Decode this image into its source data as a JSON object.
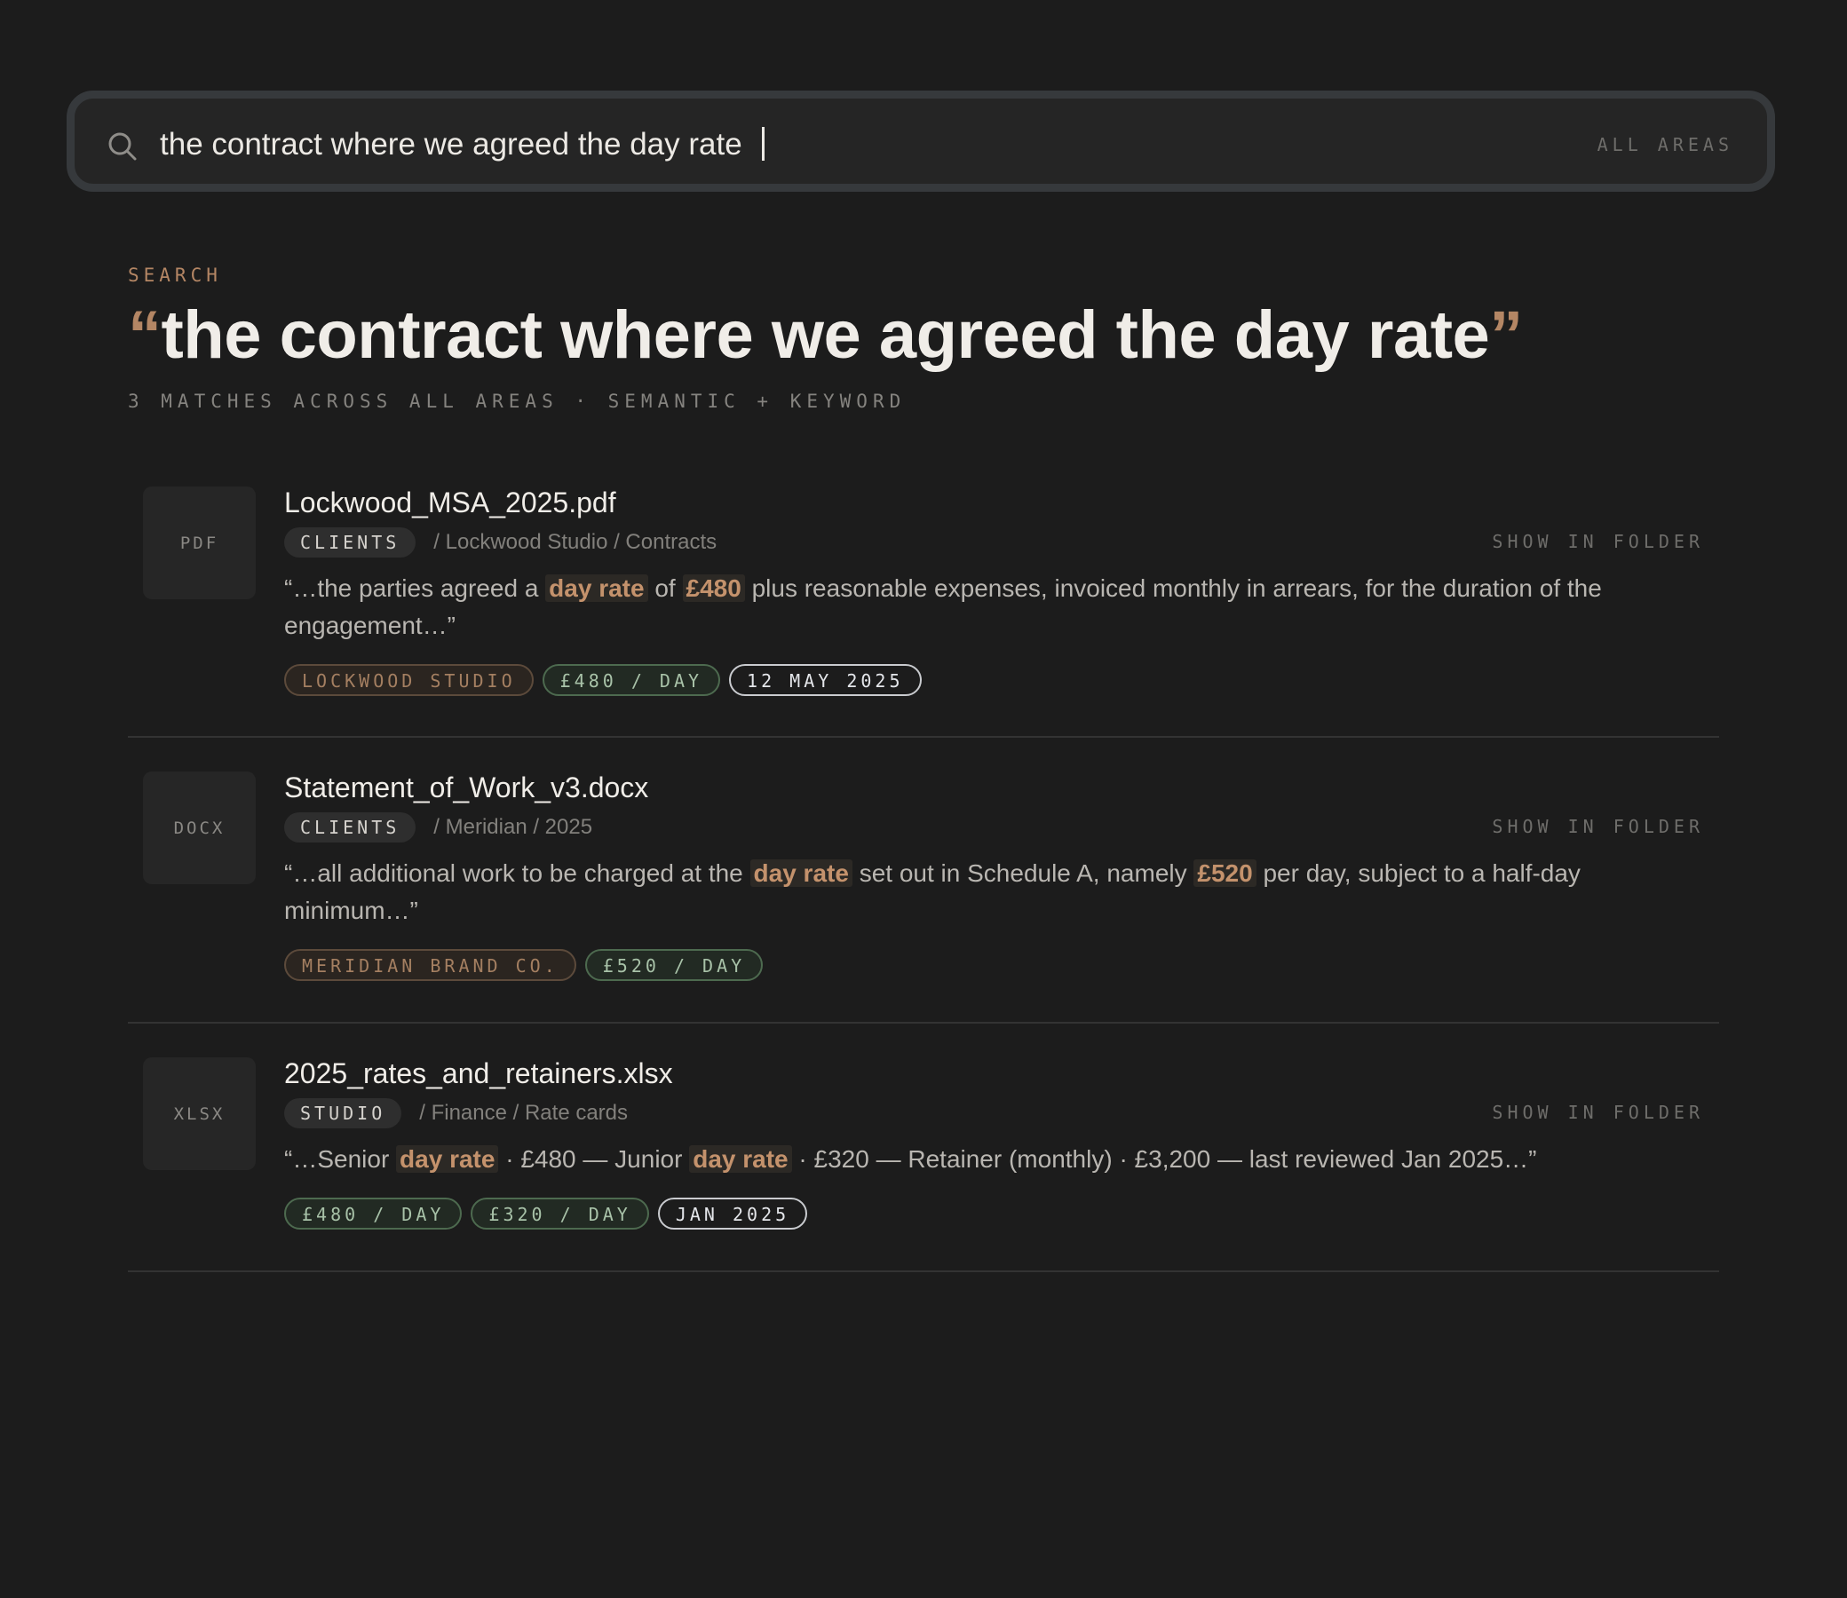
{
  "search": {
    "query": "the contract where we agreed the day rate",
    "scope": "ALL AREAS"
  },
  "header": {
    "eyebrow": "SEARCH",
    "open_quote": "“",
    "title": "the contract where we agreed the day rate",
    "close_quote": "”",
    "summary": "3 MATCHES ACROSS ALL AREAS · SEMANTIC + KEYWORD"
  },
  "results": [
    {
      "type": "PDF",
      "filename": "Lockwood_MSA_2025.pdf",
      "area": "CLIENTS",
      "path": "/ Lockwood Studio / Contracts",
      "action": "SHOW IN FOLDER",
      "snippet": [
        {
          "t": "“…the parties agreed a "
        },
        {
          "t": "day rate",
          "hl": true
        },
        {
          "t": " of "
        },
        {
          "t": "£480",
          "hl": true
        },
        {
          "t": " plus reasonable expenses, invoiced monthly in arrears, for the duration of the engagement…”"
        }
      ],
      "tags": [
        {
          "label": "LOCKWOOD STUDIO",
          "kind": "org"
        },
        {
          "label": "£480 / DAY",
          "kind": "rate"
        },
        {
          "label": "12 MAY 2025",
          "kind": "date"
        }
      ]
    },
    {
      "type": "DOCX",
      "filename": "Statement_of_Work_v3.docx",
      "area": "CLIENTS",
      "path": "/ Meridian / 2025",
      "action": "SHOW IN FOLDER",
      "snippet": [
        {
          "t": "“…all additional work to be charged at the "
        },
        {
          "t": "day rate",
          "hl": true
        },
        {
          "t": " set out in Schedule A, namely "
        },
        {
          "t": "£520",
          "hl": true
        },
        {
          "t": " per day, subject to a half-day minimum…”"
        }
      ],
      "tags": [
        {
          "label": "MERIDIAN BRAND CO.",
          "kind": "org"
        },
        {
          "label": "£520 / DAY",
          "kind": "rate"
        }
      ]
    },
    {
      "type": "XLSX",
      "filename": "2025_rates_and_retainers.xlsx",
      "area": "STUDIO",
      "path": "/ Finance / Rate cards",
      "action": "SHOW IN FOLDER",
      "snippet": [
        {
          "t": "“…Senior "
        },
        {
          "t": "day rate",
          "hl": true
        },
        {
          "t": " · £480 — Junior "
        },
        {
          "t": "day rate",
          "hl": true
        },
        {
          "t": " · £320 — Retainer (monthly) · £3,200 — last reviewed Jan 2025…”"
        }
      ],
      "tags": [
        {
          "label": "£480 / DAY",
          "kind": "rate"
        },
        {
          "label": "£320 / DAY",
          "kind": "rate"
        },
        {
          "label": "JAN 2025",
          "kind": "date"
        }
      ]
    }
  ],
  "colors": {
    "background": "#1c1c1c",
    "accent": "#b48664",
    "highlight": "#c4926c",
    "rate_tag": "#a8c2a8"
  },
  "icons": {
    "search": "search-icon"
  }
}
